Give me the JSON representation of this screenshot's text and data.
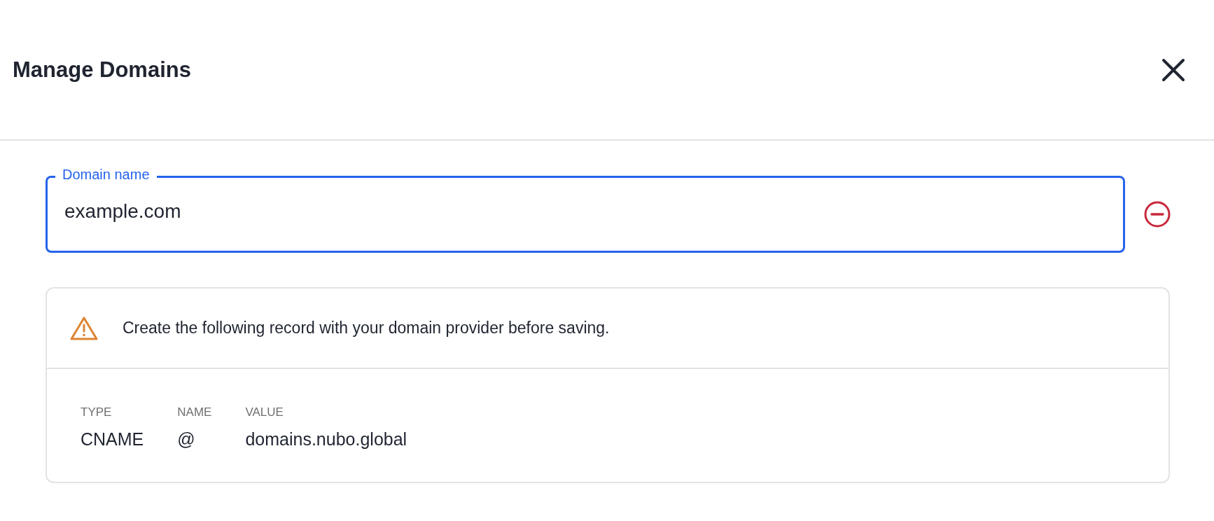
{
  "dialog": {
    "title": "Manage Domains"
  },
  "domain_field": {
    "label": "Domain name",
    "value": "example.com",
    "focused": true
  },
  "notice": {
    "text": "Create the following record with your domain provider before saving."
  },
  "record": [
    {
      "header": "TYPE",
      "value": "CNAME"
    },
    {
      "header": "NAME",
      "value": "@"
    },
    {
      "header": "VALUE",
      "value": "domains.nubo.global"
    }
  ]
}
